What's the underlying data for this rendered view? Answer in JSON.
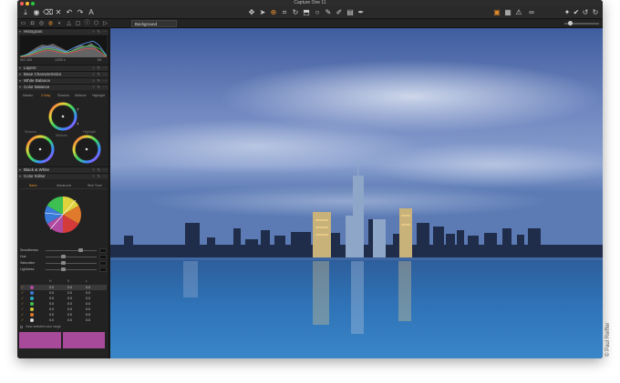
{
  "app": {
    "title": "Capture One 11"
  },
  "toolbar": {
    "left_icons": [
      "import-icon",
      "camera-icon",
      "delete-icon",
      "undo-icon",
      "redo-icon",
      "reset-icon",
      "text-icon"
    ],
    "center_icons": [
      "pan-icon",
      "select-icon",
      "zoom-icon",
      "crop-icon",
      "rotate-icon",
      "keystone-icon",
      "spot-icon",
      "brush-icon",
      "erase-icon",
      "gradient-icon",
      "picker-icon"
    ],
    "right_icons": [
      "view-icon",
      "grid-icon",
      "warning-icon",
      "glasses-icon",
      "copy-icon",
      "apply-icon",
      "rotate-left-icon",
      "rotate-right-icon"
    ]
  },
  "subbar": {
    "tool_tabs": [
      "folder-icon",
      "capture-icon",
      "lens-icon",
      "color-icon",
      "exposure-icon",
      "detail-icon",
      "local-icon",
      "meta-icon",
      "output-icon",
      "batch-icon",
      "style-icon"
    ],
    "layer_select": "Background"
  },
  "sidebar": {
    "histogram": {
      "title": "Histogram",
      "iso": "ISO 400",
      "shutter": "1/200 s",
      "aperture": "f/8"
    },
    "panels": [
      "Layers",
      "Base Characteristics",
      "White Balance",
      "Color Balance"
    ],
    "color_balance": {
      "tabs": [
        "Master",
        "3-Way",
        "Shadow",
        "Midtone",
        "Highlight"
      ],
      "active_tab": "3-Way",
      "wheel_labels": [
        "Shadow",
        "Midtone",
        "Highlight"
      ]
    },
    "panels2": [
      "Black & White",
      "Color Editor"
    ],
    "color_editor": {
      "tabs": [
        "Basic",
        "Advanced",
        "Skin Tone"
      ],
      "active_tab": "Basic",
      "sliders": [
        "Smoothness",
        "Hue",
        "Saturation",
        "Lightness"
      ],
      "table_headers": [
        "H",
        "S",
        "L"
      ],
      "rows": [
        {
          "color": "#b04aa0",
          "h": "0.0",
          "s": "0.0",
          "l": "0.0"
        },
        {
          "color": "#3a7ad8",
          "h": "0.0",
          "s": "0.0",
          "l": "0.0"
        },
        {
          "color": "#2ea6c8",
          "h": "0.0",
          "s": "0.0",
          "l": "0.0"
        },
        {
          "color": "#3dbf52",
          "h": "0.0",
          "s": "0.0",
          "l": "0.0"
        },
        {
          "color": "#c8c83a",
          "h": "0.0",
          "s": "0.0",
          "l": "0.0"
        },
        {
          "color": "#e07a2c",
          "h": "0.0",
          "s": "0.0",
          "l": "0.0"
        },
        {
          "color": "#d8d8d8",
          "h": "0.0",
          "s": "0.0",
          "l": "0.0"
        }
      ],
      "view_range": "View selected color range"
    }
  },
  "credit": "© Paul Reiffer"
}
